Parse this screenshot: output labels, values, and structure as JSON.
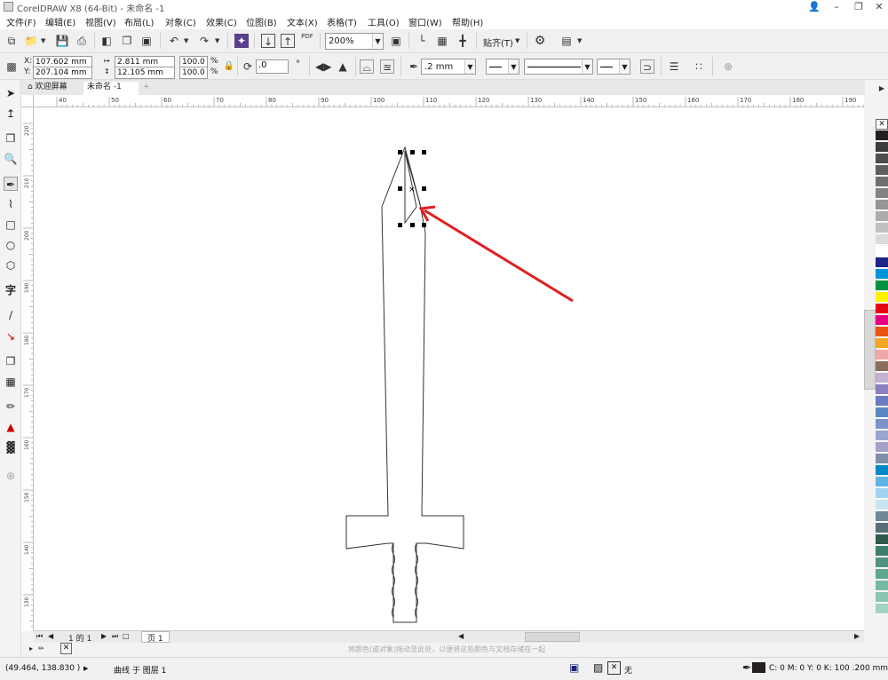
{
  "window": {
    "title": "CorelDRAW X8 (64-Bit) - 未命名 -1",
    "buttons": [
      "?",
      "□",
      "✕"
    ]
  },
  "menu": [
    "文件(F)",
    "编辑(E)",
    "视图(V)",
    "布局(L)",
    "对象(C)",
    "效果(C)",
    "位图(B)",
    "文本(X)",
    "表格(T)",
    "工具(O)",
    "窗口(W)",
    "帮助(H)"
  ],
  "standard_toolbar": {
    "pdf_label": "PDF",
    "zoom_value": "200%",
    "snap_label": "贴齐(T)"
  },
  "property_bar": {
    "x_label": "X:",
    "x_value": "107.602 mm",
    "y_label": "Y:",
    "y_value": "207.104 mm",
    "width_value": "2.811 mm",
    "height_value": "12.105 mm",
    "scale_w": "100.0",
    "scale_h": "100.0",
    "percent": "%",
    "rotation_value": ".0",
    "outline_width": ".2 mm"
  },
  "tabs": [
    {
      "label": "欢迎屏幕"
    },
    {
      "label": "未命名 -1"
    }
  ],
  "ruler_h_labels": [
    "40",
    "50",
    "60",
    "70",
    "80",
    "90",
    "100",
    "110",
    "120",
    "130",
    "140",
    "150",
    "160",
    "170",
    "180",
    "190"
  ],
  "ruler_v_labels": [
    "220",
    "210",
    "200",
    "190",
    "180",
    "170",
    "160",
    "150",
    "140",
    "130"
  ],
  "page_nav": {
    "of_text": "1 的 1",
    "page_tab": "页 1"
  },
  "color_hint": "将颜色(或对象)拖动至此处，以便将这些颜色与文档存储在一起",
  "status": {
    "coords": "(49.464, 138.830 )",
    "object_info": "曲线 于 图层 1",
    "fill_none": "无",
    "outline_info": "C: 0 M: 0 Y: 0 K: 100  .200 mm"
  },
  "palette_colors": [
    "#231f20",
    "#3d3b3c",
    "#4e4c4d",
    "#5f5d5e",
    "#706e6f",
    "#838182",
    "#979596",
    "#acaaab",
    "#c2c0c1",
    "#dcdadb",
    "#ffffff",
    "#1c2484",
    "#0094d9",
    "#00923f",
    "#fff100",
    "#e30613",
    "#e4007f",
    "#ea5413",
    "#f5a623",
    "#f0a7a7",
    "#8b6d5c",
    "#c3b1d4",
    "#8b7fbf",
    "#6c7bbf",
    "#5b87c5",
    "#7c93c9",
    "#9aa5d0",
    "#a6a1c9",
    "#7f8fa8",
    "#0088c8",
    "#5fb4e6",
    "#9fd3f0",
    "#c8e4f2",
    "#6f8797",
    "#5a6e79",
    "#2d5a4d",
    "#3c7d6b",
    "#4e9480",
    "#5fa78f",
    "#74b9a0",
    "#89c5b0",
    "#a2d3c1"
  ]
}
